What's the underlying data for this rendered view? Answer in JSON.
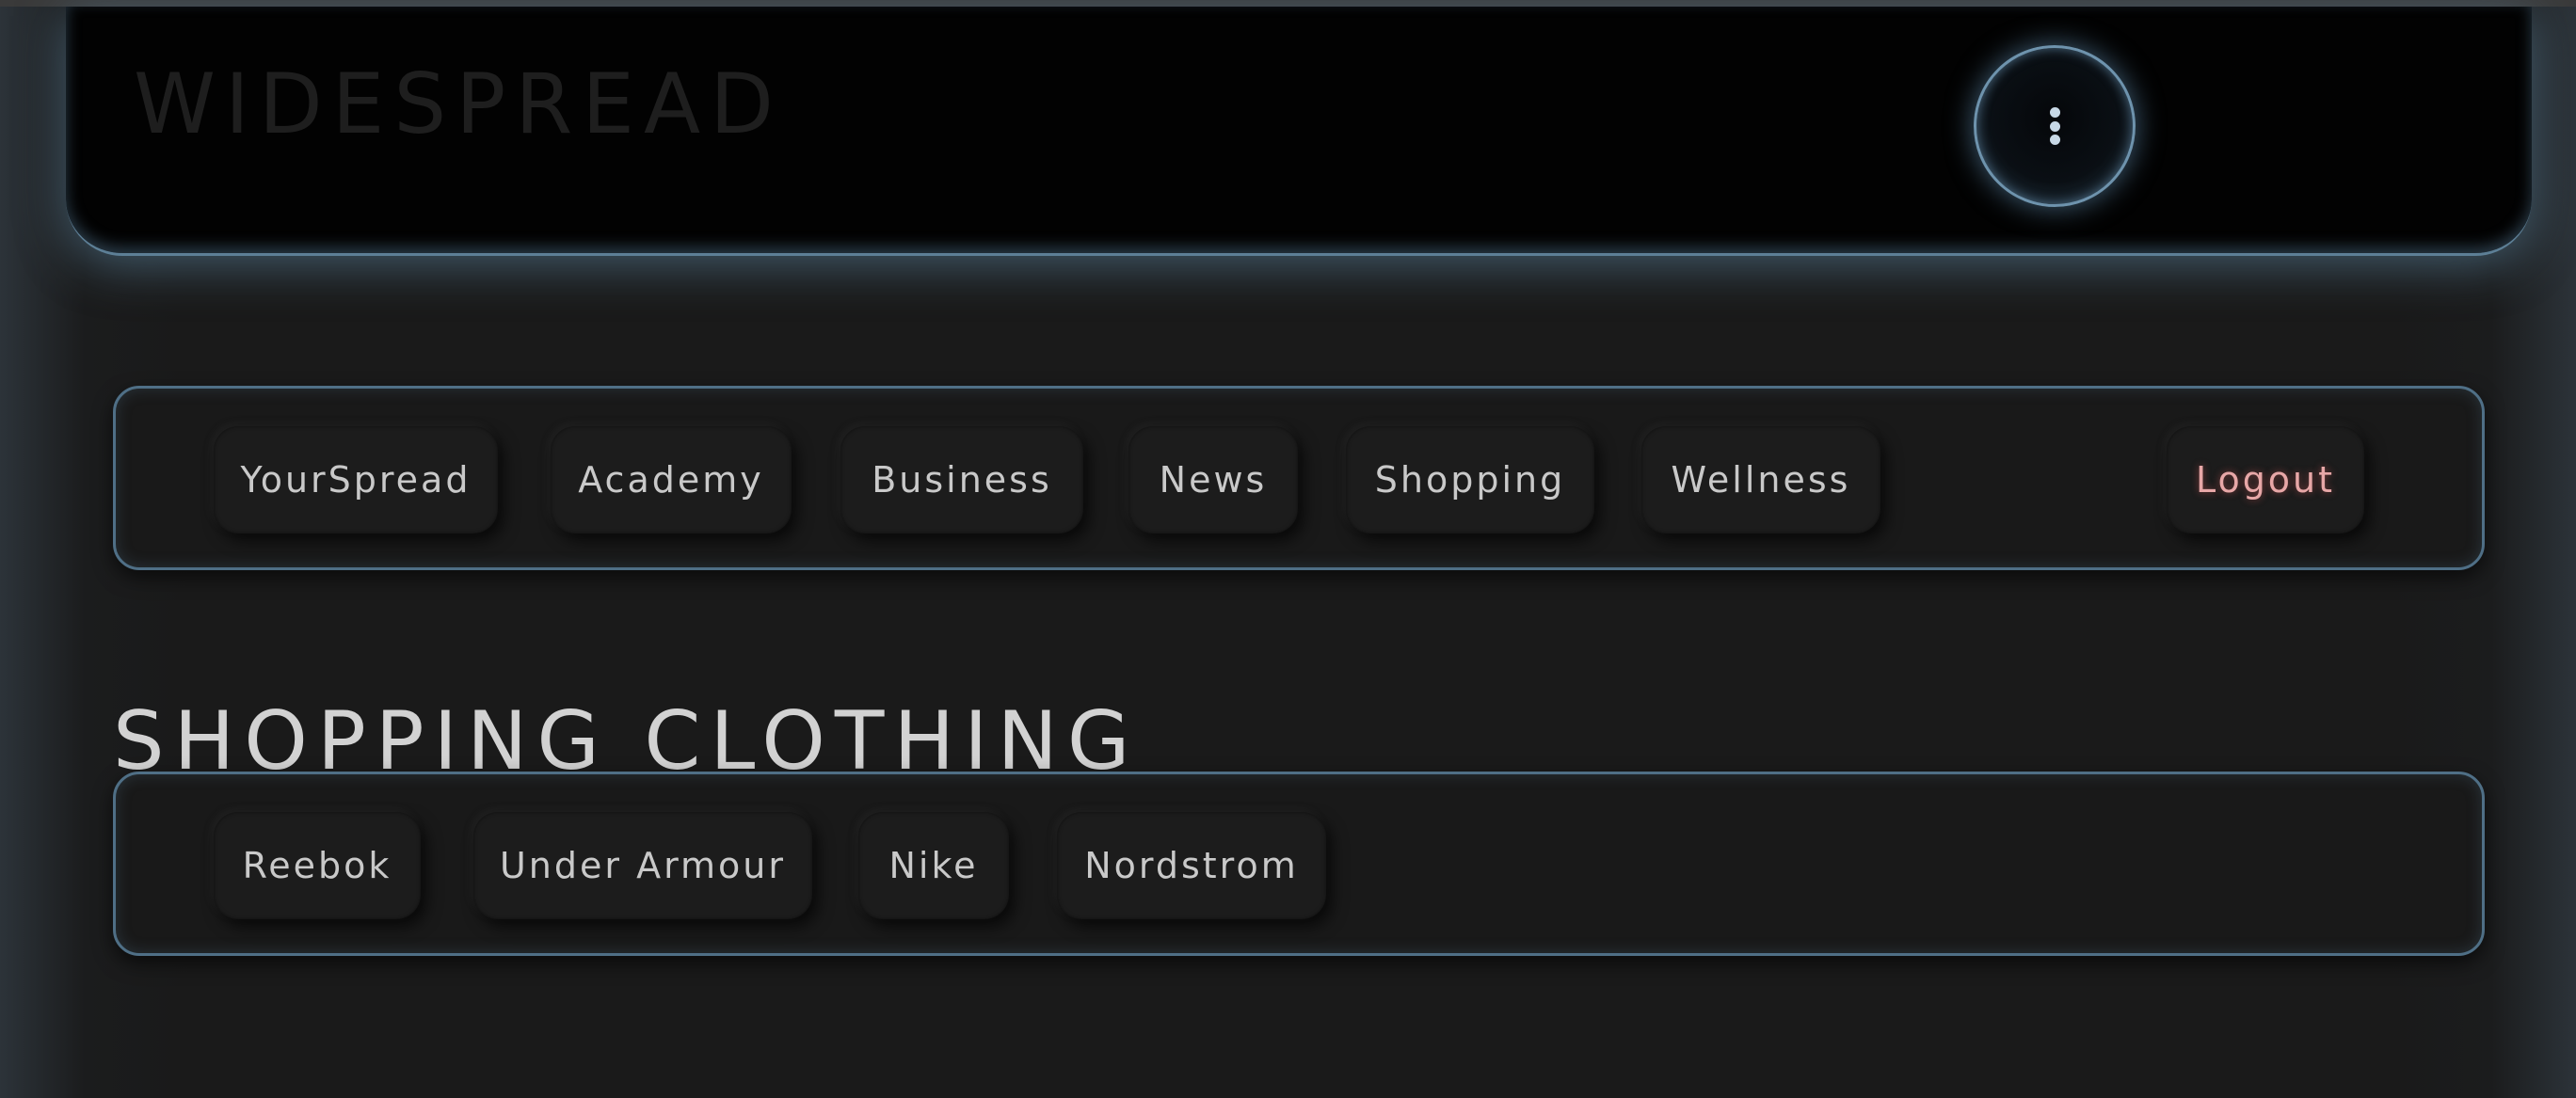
{
  "header": {
    "brand": "WIDESPREAD",
    "menu_icon": "kebab-menu-icon"
  },
  "nav": {
    "items": [
      {
        "label": "YourSpread"
      },
      {
        "label": "Academy"
      },
      {
        "label": "Business"
      },
      {
        "label": "News"
      },
      {
        "label": "Shopping"
      },
      {
        "label": "Wellness"
      }
    ],
    "logout_label": "Logout",
    "logout_color": "#e7a7a7"
  },
  "section": {
    "title": "SHOPPING CLOTHING"
  },
  "brands": {
    "items": [
      {
        "label": "Reebok"
      },
      {
        "label": "Under Armour"
      },
      {
        "label": "Nike"
      },
      {
        "label": "Nordstrom"
      }
    ]
  },
  "colors": {
    "accent_glow": "#5d7f96",
    "background": "#1a1a1a",
    "header_bg": "#020202"
  }
}
